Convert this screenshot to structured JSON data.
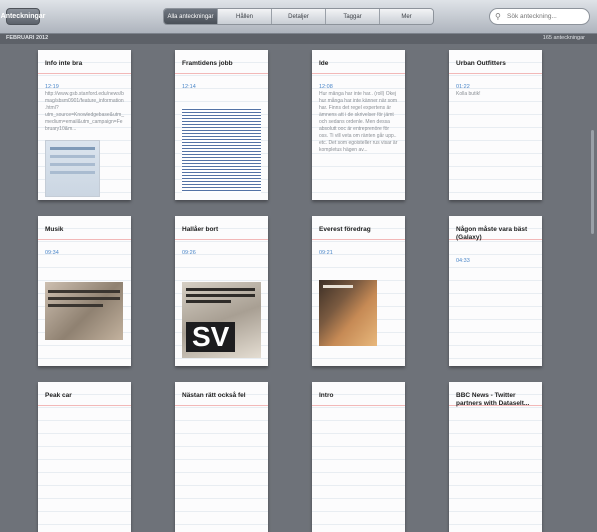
{
  "toolbar": {
    "back_label": "Anteckningar",
    "tabs": [
      "Alla anteckningar",
      "Hållen",
      "Detaljer",
      "Taggar",
      "Mer"
    ],
    "search_placeholder": "Sök anteckning..."
  },
  "header": {
    "month": "FEBRUARI 2012",
    "count": "165 anteckningar"
  },
  "notes": [
    {
      "title": "Info inte bra",
      "time": "12:19",
      "body": "http://www.gsb.stanford.edu/news/bmag/sbsm0901/feature_information.html?utm_source=Knowledgebase&utm_medium=email&utm_campaign=February10&m..."
    },
    {
      "title": "Framtidens jobb",
      "time": "12:14",
      "body": ""
    },
    {
      "title": "Ide",
      "time": "12:08",
      "body": "Hur många har inte har.. (roll) Ökej hur många har inte känner när som har. Finns det regel expertens är ämnens att i de skrivelser för jämt och sedans ordenle. Men dessa absolutt ooc är entreprenöre för oss. Ti vill veta om ränten går upp.. etc. Det som egoisteller rus visar är kompletus hägen av..."
    },
    {
      "title": "Urban Outfitters",
      "time": "01:22",
      "body": "Kolla butik!"
    },
    {
      "title": "Musik",
      "time": "09:34",
      "body": ""
    },
    {
      "title": "Hallåer bort",
      "time": "09:26",
      "body": ""
    },
    {
      "title": "Everest föredrag",
      "time": "09:21",
      "body": ""
    },
    {
      "title": "Någon måste vara bäst (Galaxy)",
      "time": "04:33",
      "body": ""
    },
    {
      "title": "Peak car",
      "time": "",
      "body": ""
    },
    {
      "title": "Nästan rätt också fel",
      "time": "",
      "body": ""
    },
    {
      "title": "Intro",
      "time": "",
      "body": ""
    },
    {
      "title": "BBC News - Twitter partners with Dataselt...",
      "time": "",
      "body": ""
    }
  ],
  "thumb_text": {
    "sv": "SV"
  },
  "colors": {
    "background": "#6e7279",
    "time": "#4a86c8",
    "title": "#222222"
  }
}
